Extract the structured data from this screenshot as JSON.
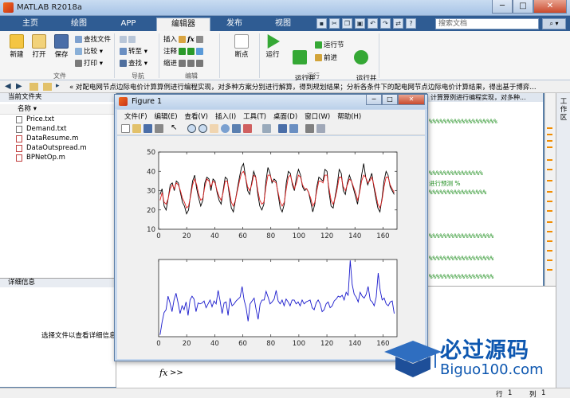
{
  "app": {
    "title": "MATLAB R2018a"
  },
  "tabs": [
    "主页",
    "绘图",
    "APP",
    "编辑器",
    "发布",
    "视图"
  ],
  "search": {
    "placeholder": "搜索文档"
  },
  "ribbon": {
    "file": {
      "new": "新建",
      "open": "打开",
      "save": "保存",
      "find_files": "查找文件",
      "compare": "比较",
      "print": "打印",
      "group": "文件"
    },
    "nav": {
      "goto": "转至",
      "find": "查找",
      "group": "导航"
    },
    "edit": {
      "insert": "插入",
      "comment": "注释",
      "indent": "缩进",
      "fx": "fx",
      "group": "编辑"
    },
    "breakpoints": {
      "label": "断点"
    },
    "run": {
      "run": "运行",
      "run_advance": "运行并\n前进",
      "run_section": "运行节",
      "advance": "前进",
      "run_time": "运行并\n计时",
      "group": "运行"
    }
  },
  "addressbar": {
    "path": "« 对配电网节点边际电价计算算例进行编程实现，对多种方案分别进行解算，得到规划结果；分析各条件下的配电网节点边际电价计算结果，得出基于博弈..."
  },
  "current_folder": {
    "title": "当前文件夹",
    "column": "名称 ▾",
    "files": [
      {
        "name": "Price.txt",
        "type": "txt"
      },
      {
        "name": "Demand.txt",
        "type": "txt"
      },
      {
        "name": "DataResume.m",
        "type": "m"
      },
      {
        "name": "DataOutspread.m",
        "type": "m"
      },
      {
        "name": "BPNetOp.m",
        "type": "m"
      }
    ]
  },
  "details": {
    "title": "详细信息",
    "message": "选择文件以查看详细信息"
  },
  "editor": {
    "tab_text": "计算算例进行编程实现，对多种...",
    "lines": [
      "%%%%%%%%%%%%%%%%%%%",
      "%%%%%%%%%%%%%%%",
      "进行预测    %",
      "%%%%%%%%%%%%%%%%",
      "%%%%%%%%%%%%%%%%%%",
      "%%%%%%%%%%%%%%%%%%",
      "%%%%%%%%%%%%%%%%%%"
    ]
  },
  "workspace": {
    "label": "工作区"
  },
  "command": {
    "prompt_fx": "fx",
    "prompt": ">>"
  },
  "status": {
    "row_label": "行",
    "row": "1",
    "col_label": "列",
    "col": "1"
  },
  "figure": {
    "title": "Figure 1",
    "menu": [
      "文件(F)",
      "编辑(E)",
      "查看(V)",
      "插入(I)",
      "工具(T)",
      "桌面(D)",
      "窗口(W)",
      "帮助(H)"
    ]
  },
  "colors": {
    "actual": "#000000",
    "predicted": "#e02020",
    "error": "#1a1acc",
    "accent": "#2f5c93"
  },
  "chart_data": [
    {
      "type": "line",
      "xlim": [
        0,
        170
      ],
      "ylim": [
        10,
        50
      ],
      "xticks": [
        0,
        20,
        40,
        60,
        80,
        100,
        120,
        140,
        160
      ],
      "yticks": [
        10,
        20,
        30,
        40,
        50
      ],
      "series": [
        {
          "color": "#000000",
          "values": [
            28,
            31,
            22,
            20,
            26,
            33,
            34,
            30,
            35,
            34,
            29,
            24,
            22,
            18,
            20,
            28,
            35,
            38,
            31,
            26,
            22,
            25,
            34,
            37,
            36,
            30,
            36,
            35,
            29,
            25,
            23,
            30,
            37,
            36,
            28,
            21,
            19,
            25,
            31,
            37,
            42,
            44,
            37,
            30,
            28,
            34,
            40,
            37,
            28,
            22,
            20,
            23,
            35,
            42,
            39,
            34,
            36,
            35,
            28,
            21,
            19,
            23,
            34,
            40,
            39,
            33,
            30,
            37,
            41,
            38,
            32,
            30,
            31,
            29,
            24,
            19,
            23,
            32,
            37,
            36,
            35,
            41,
            40,
            29,
            22,
            21,
            27,
            33,
            41,
            39,
            30,
            28,
            34,
            38,
            35,
            31,
            27,
            23,
            30,
            38,
            44,
            37,
            33,
            36,
            39,
            32,
            26,
            21,
            19,
            26,
            35,
            40,
            38,
            32,
            30,
            28
          ]
        },
        {
          "color": "#e02020",
          "values": [
            25,
            29,
            24,
            23,
            26,
            31,
            33,
            31,
            34,
            33,
            30,
            26,
            24,
            21,
            22,
            27,
            33,
            36,
            33,
            28,
            25,
            26,
            32,
            36,
            35,
            32,
            35,
            34,
            30,
            27,
            25,
            29,
            35,
            35,
            30,
            24,
            22,
            25,
            30,
            35,
            39,
            40,
            37,
            32,
            30,
            33,
            38,
            37,
            30,
            25,
            23,
            24,
            32,
            38,
            38,
            35,
            35,
            34,
            29,
            24,
            22,
            24,
            31,
            37,
            38,
            34,
            31,
            34,
            38,
            37,
            33,
            31,
            31,
            29,
            26,
            22,
            24,
            30,
            35,
            35,
            34,
            38,
            38,
            31,
            25,
            23,
            26,
            31,
            37,
            37,
            32,
            30,
            33,
            36,
            35,
            32,
            29,
            25,
            29,
            35,
            38,
            37,
            34,
            35,
            37,
            33,
            28,
            23,
            21,
            25,
            32,
            37,
            37,
            33,
            31,
            29
          ]
        }
      ]
    },
    {
      "type": "line",
      "xlim": [
        0,
        170
      ],
      "ylim": [
        -4,
        4
      ],
      "xticks": [
        0,
        20,
        40,
        60,
        80,
        100,
        120,
        140,
        160
      ],
      "yticks": [],
      "series": [
        {
          "color": "#1a1acc",
          "values": [
            -3.8,
            -2.5,
            -1.5,
            -1.2,
            0.2,
            -0.5,
            -1.4,
            -0.2,
            0.5,
            -0.5,
            -1.6,
            -0.8,
            -1.2,
            -0.4,
            -1.8,
            -0.2,
            0.2,
            -0.1,
            -1.4,
            -0.5,
            -0.6,
            -0.5,
            -0.3,
            -1.0,
            -0.6,
            -0.2,
            -0.9,
            -0.3,
            -0.6,
            0.8,
            -0.3,
            -1.6,
            -0.5,
            -0.4,
            -1.8,
            0.0,
            -0.8,
            -0.6,
            -0.3,
            -0.1,
            0.1,
            1.2,
            -0.2,
            -1.0,
            -2.4,
            -0.6,
            -0.3,
            0.0,
            -1.2,
            -2.2,
            -0.6,
            -0.2,
            -0.2,
            0.7,
            0.1,
            -0.6,
            -0.4,
            -0.1,
            0.8,
            -0.3,
            -0.6,
            -0.2,
            -0.8,
            -0.1,
            -0.4,
            -0.8,
            -0.2,
            -0.2,
            -0.6,
            -0.4,
            -0.8,
            -0.2,
            -0.6,
            -0.4,
            -0.3,
            -0.2,
            -1.0,
            -1.2,
            -0.5,
            -0.2,
            -0.6,
            -1.4,
            -1.2,
            -0.6,
            -0.4,
            -1.0,
            -0.8,
            -0.3,
            -0.1,
            0.2,
            0.1,
            0.3,
            -0.2,
            0.6,
            0.3,
            3.9,
            1.4,
            0.4,
            0.1,
            -0.4,
            0.6,
            0.2,
            0.0,
            0.4,
            1.2,
            -0.2,
            -0.4,
            -0.8,
            0.1,
            2.6,
            0.8,
            -0.2,
            0.0,
            -0.6,
            -0.8,
            -0.4,
            -0.3,
            -1.6
          ]
        }
      ]
    }
  ]
}
